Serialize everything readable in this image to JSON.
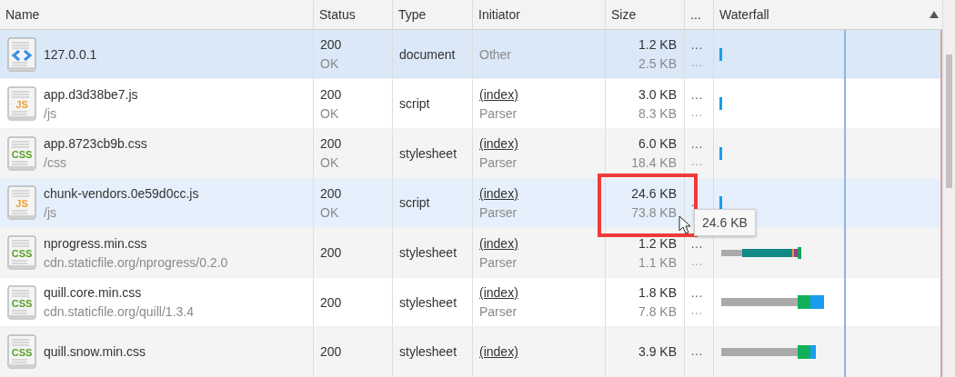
{
  "columns": [
    "Name",
    "Status",
    "Type",
    "Initiator",
    "Size",
    "...",
    "Waterfall"
  ],
  "rows": [
    {
      "icon": {
        "kind": "document"
      },
      "name": "127.0.0.1",
      "path": "",
      "status": "200",
      "status_text": "OK",
      "type": "document",
      "initiator": "Other",
      "initiator_detail": "",
      "size": "1.2 KB",
      "resource_size": "2.5 KB",
      "more": [
        "...",
        "..."
      ],
      "waterfall": {
        "kind": "tick"
      },
      "selected": true,
      "hovered": false,
      "highlighted": false
    },
    {
      "icon": {
        "kind": "script",
        "label": "JS"
      },
      "name": "app.d3d38be7.js",
      "path": "/js",
      "status": "200",
      "status_text": "OK",
      "type": "script",
      "initiator": "(index)",
      "initiator_detail": "Parser",
      "size": "3.0 KB",
      "resource_size": "8.3 KB",
      "more": [
        "...",
        "..."
      ],
      "waterfall": {
        "kind": "tick"
      },
      "selected": false,
      "hovered": false,
      "highlighted": false
    },
    {
      "icon": {
        "kind": "stylesheet",
        "label": "CSS"
      },
      "name": "app.8723cb9b.css",
      "path": "/css",
      "status": "200",
      "status_text": "OK",
      "type": "stylesheet",
      "initiator": "(index)",
      "initiator_detail": "Parser",
      "size": "6.0 KB",
      "resource_size": "18.4 KB",
      "more": [
        "...",
        "..."
      ],
      "waterfall": {
        "kind": "tick"
      },
      "selected": false,
      "hovered": false,
      "highlighted": false
    },
    {
      "icon": {
        "kind": "script",
        "label": "JS"
      },
      "name": "chunk-vendors.0e59d0cc.js",
      "path": "/js",
      "status": "200",
      "status_text": "OK",
      "type": "script",
      "initiator": "(index)",
      "initiator_detail": "Parser",
      "size": "24.6 KB",
      "resource_size": "73.8 KB",
      "more": [
        "."
      ],
      "waterfall": {
        "kind": "tick"
      },
      "selected": false,
      "hovered": true,
      "highlighted": true
    },
    {
      "icon": {
        "kind": "stylesheet",
        "label": "CSS"
      },
      "name": "nprogress.min.css",
      "path": "cdn.staticfile.org/nprogress/0.2.0",
      "status": "200",
      "status_text": "",
      "type": "stylesheet",
      "initiator": "(index)",
      "initiator_detail": "Parser",
      "size": "1.2 KB",
      "resource_size": "1.1 KB",
      "more": [
        "...",
        "..."
      ],
      "waterfall": {
        "kind": "download"
      },
      "selected": false,
      "hovered": false,
      "highlighted": false
    },
    {
      "icon": {
        "kind": "stylesheet",
        "label": "CSS"
      },
      "name": "quill.core.min.css",
      "path": "cdn.staticfile.org/quill/1.3.4",
      "status": "200",
      "status_text": "",
      "type": "stylesheet",
      "initiator": "(index)",
      "initiator_detail": "Parser",
      "size": "1.8 KB",
      "resource_size": "7.8 KB",
      "more": [
        "...",
        "..."
      ],
      "waterfall": {
        "kind": "full"
      },
      "selected": false,
      "hovered": false,
      "highlighted": false
    },
    {
      "icon": {
        "kind": "stylesheet",
        "label": "CSS"
      },
      "name": "quill.snow.min.css",
      "path": "",
      "status": "200",
      "status_text": "",
      "type": "stylesheet",
      "initiator": "(index)",
      "initiator_detail": "",
      "size": "3.9 KB",
      "resource_size": "",
      "more": [
        "..."
      ],
      "waterfall": {
        "kind": "partial"
      },
      "selected": false,
      "hovered": false,
      "highlighted": false
    }
  ],
  "tooltip": "24.6 KB"
}
